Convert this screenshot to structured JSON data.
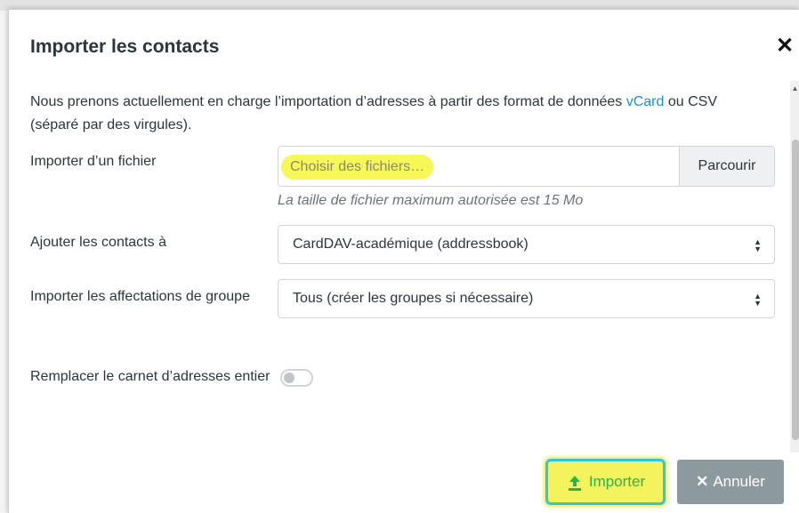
{
  "dialog": {
    "title": "Importer les contacts",
    "close_icon": "close-icon"
  },
  "intro": {
    "text_before": "Nous prenons actuellement en charge l’importation d’adresses à partir des format de données ",
    "link": "vCard",
    "text_after": " ou CSV (séparé par des virgules)."
  },
  "file": {
    "label": "Importer d’un fichier",
    "placeholder": "Choisir des fichiers…",
    "browse": "Parcourir",
    "help": "La taille de fichier maximum autorisée est 15 Mo"
  },
  "target": {
    "label": "Ajouter les contacts à",
    "value": "CardDAV-académique (addressbook)"
  },
  "groups": {
    "label": "Importer les affectations de groupe",
    "value": "Tous (créer les groupes si nécessaire)"
  },
  "replace": {
    "label": "Remplacer le carnet d’adresses entier",
    "enabled": false
  },
  "footer": {
    "import": "Importer",
    "cancel": "Annuler"
  },
  "colors": {
    "link": "#1d8fd1",
    "highlight": "#f7f758",
    "import_text": "#2cb34a",
    "cancel_bg": "#8c9a9f"
  }
}
